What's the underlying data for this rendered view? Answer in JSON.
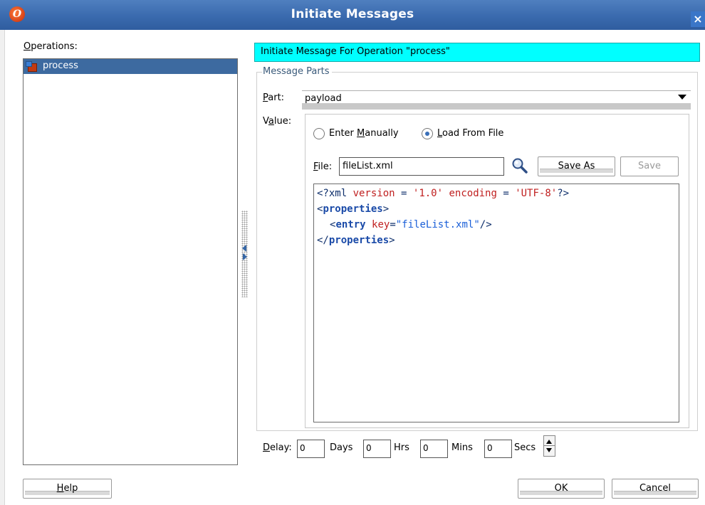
{
  "window": {
    "title": "Initiate Messages",
    "close_label": "×"
  },
  "operations": {
    "label": "Operations:",
    "items": [
      {
        "label": "process",
        "selected": true
      }
    ]
  },
  "header": {
    "text": "Initiate Message For Operation \"process\""
  },
  "message_parts": {
    "legend": "Message Parts",
    "part_label": "Part:",
    "part_value": "payload",
    "value_label": "Value:",
    "radio_manual": "Enter Manually",
    "radio_file": "Load From File",
    "selected_mode": "Load From File",
    "file_label": "File:",
    "file_value": "fileList.xml",
    "save_as_label": "Save As",
    "save_label": "Save"
  },
  "xml": {
    "line1_a": "<?xml ",
    "line1_b": "version",
    "line1_c": " = ",
    "line1_d": "'1.0'",
    "line1_e": " encoding",
    "line1_f": " = ",
    "line1_g": "'UTF-8'",
    "line1_h": "?>",
    "line2_open": "<",
    "line2_tag": "properties",
    "line2_close": ">",
    "line3_open": "<",
    "line3_tag": "entry",
    "line3_attr": " key",
    "line3_eq": "=",
    "line3_val": "\"fileList.xml\"",
    "line3_close": "/>",
    "line4_open": "</",
    "line4_tag": "properties",
    "line4_close": ">"
  },
  "delay": {
    "label": "Delay:",
    "days_value": "0",
    "days_label": "Days",
    "hrs_value": "0",
    "hrs_label": "Hrs",
    "mins_value": "0",
    "mins_label": "Mins",
    "secs_value": "0",
    "secs_label": "Secs"
  },
  "buttons": {
    "help": "Help",
    "ok": "OK",
    "cancel": "Cancel"
  },
  "colors": {
    "titlebar": "#3a6aae",
    "header_bg": "#00ffff",
    "selection": "#3d6aa0"
  }
}
